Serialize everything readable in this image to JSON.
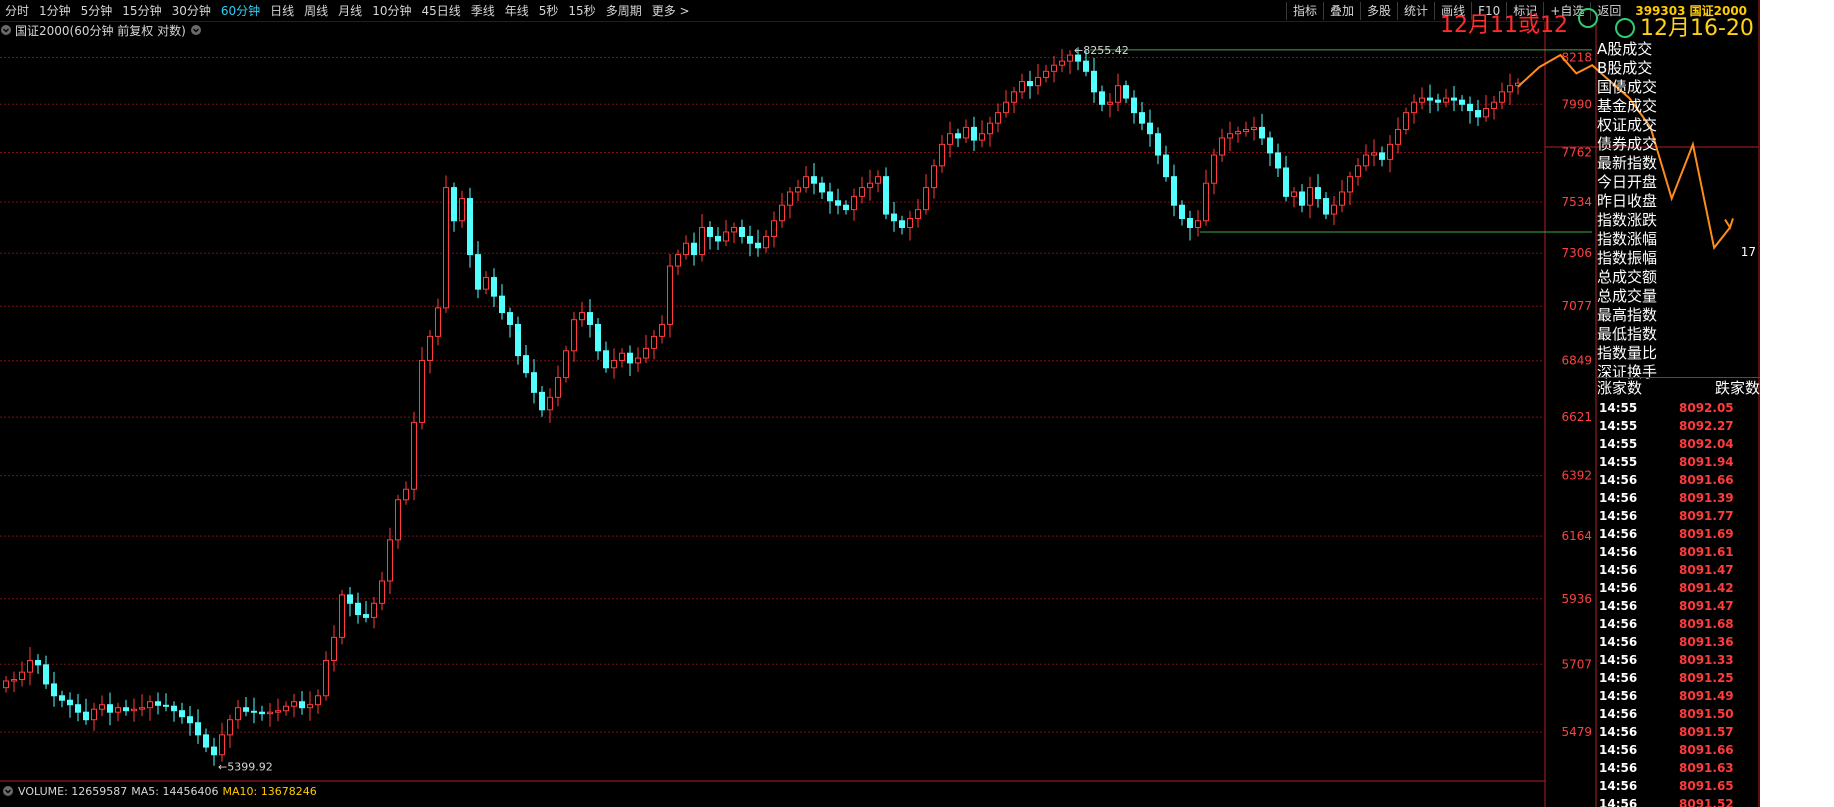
{
  "toolbar": {
    "periods": [
      "分时",
      "1分钟",
      "5分钟",
      "15分钟",
      "30分钟",
      "60分钟",
      "日线",
      "周线",
      "月线",
      "10分钟",
      "45日线",
      "季线",
      "年线",
      "5秒",
      "15秒",
      "多周期",
      "更多 >"
    ],
    "active_period": "60分钟",
    "tools": [
      "指标",
      "叠加",
      "多股",
      "统计",
      "画线",
      "F10",
      "标记",
      "+自选",
      "返回"
    ],
    "index_code": "399303 国证2000"
  },
  "chart_title": "国证2000(60分钟 前复权 对数)",
  "annotations": {
    "red_text": "12月11或12",
    "yellow_text": "12月16-20",
    "right_edge_label": "17"
  },
  "side_panel": {
    "fields": [
      "A股成交",
      "B股成交",
      "国债成交",
      "基金成交",
      "权证成交",
      "债券成交",
      "最新指数",
      "今日开盘",
      "昨日收盘",
      "指数涨跌",
      "指数涨幅",
      "指数振幅",
      "总成交额",
      "总成交量",
      "最高指数",
      "最低指数",
      "指数量比",
      "深证换手"
    ],
    "rise_label": "涨家数",
    "fall_label": "跌家数"
  },
  "ticks": [
    {
      "time": "14:55",
      "price": "8092.05"
    },
    {
      "time": "14:55",
      "price": "8092.27"
    },
    {
      "time": "14:55",
      "price": "8092.04"
    },
    {
      "time": "14:55",
      "price": "8091.94"
    },
    {
      "time": "14:56",
      "price": "8091.66"
    },
    {
      "time": "14:56",
      "price": "8091.39"
    },
    {
      "time": "14:56",
      "price": "8091.77"
    },
    {
      "time": "14:56",
      "price": "8091.69"
    },
    {
      "time": "14:56",
      "price": "8091.61"
    },
    {
      "time": "14:56",
      "price": "8091.47"
    },
    {
      "time": "14:56",
      "price": "8091.42"
    },
    {
      "time": "14:56",
      "price": "8091.47"
    },
    {
      "time": "14:56",
      "price": "8091.68"
    },
    {
      "time": "14:56",
      "price": "8091.36"
    },
    {
      "time": "14:56",
      "price": "8091.33"
    },
    {
      "time": "14:56",
      "price": "8091.25"
    },
    {
      "time": "14:56",
      "price": "8091.49"
    },
    {
      "time": "14:56",
      "price": "8091.50"
    },
    {
      "time": "14:56",
      "price": "8091.57"
    },
    {
      "time": "14:56",
      "price": "8091.66"
    },
    {
      "time": "14:56",
      "price": "8091.63"
    },
    {
      "time": "14:56",
      "price": "8091.65"
    },
    {
      "time": "14:56",
      "price": "8091.52"
    }
  ],
  "volume_bar": {
    "volume_label": "VOLUME: 12659587",
    "ma5_label": "MA5: 14456406",
    "ma10_label": "MA10: 13678246"
  },
  "colors": {
    "up": "#ff3b3b",
    "down": "#54ffff",
    "grid": "#7a1010",
    "axis_text": "#ff4040",
    "level_line": "#3fa84a",
    "projection": "#ff8c1a"
  },
  "chart_data": {
    "type": "candlestick",
    "title": "国证2000(60分钟 前复权 对数)",
    "y_scale": "log",
    "y_ticks": [
      5479,
      5707,
      5936,
      6164,
      6392,
      6621,
      6849,
      7077,
      7306,
      7534,
      7762,
      7990,
      8218
    ],
    "ylim": [
      5330,
      8380
    ],
    "marked_high": "8255.42",
    "marked_low": "5399.92",
    "level_lines": [
      8255.42,
      7400
    ],
    "closes": [
      5650,
      5655,
      5680,
      5720,
      5705,
      5640,
      5600,
      5585,
      5570,
      5545,
      5520,
      5555,
      5570,
      5545,
      5560,
      5550,
      5555,
      5560,
      5580,
      5568,
      5565,
      5550,
      5530,
      5510,
      5470,
      5430,
      5405,
      5470,
      5520,
      5560,
      5548,
      5545,
      5540,
      5545,
      5550,
      5565,
      5580,
      5560,
      5570,
      5600,
      5720,
      5800,
      5950,
      5920,
      5880,
      5870,
      5920,
      6000,
      6150,
      6300,
      6340,
      6600,
      6850,
      6950,
      7070,
      7600,
      7450,
      7550,
      7300,
      7150,
      7200,
      7120,
      7050,
      7000,
      6870,
      6800,
      6720,
      6650,
      6700,
      6780,
      6890,
      7020,
      7050,
      7000,
      6890,
      6820,
      6850,
      6880,
      6840,
      6860,
      6900,
      6950,
      7000,
      7250,
      7300,
      7350,
      7300,
      7420,
      7380,
      7360,
      7400,
      7420,
      7380,
      7350,
      7330,
      7380,
      7450,
      7520,
      7580,
      7600,
      7650,
      7620,
      7580,
      7540,
      7520,
      7500,
      7560,
      7600,
      7620,
      7650,
      7480,
      7450,
      7420,
      7460,
      7500,
      7600,
      7700,
      7800,
      7850,
      7830,
      7880,
      7820,
      7850,
      7900,
      7950,
      8000,
      8050,
      8100,
      8080,
      8120,
      8150,
      8180,
      8200,
      8230,
      8200,
      8150,
      8050,
      7990,
      8000,
      8080,
      8020,
      7950,
      7900,
      7850,
      7750,
      7650,
      7520,
      7460,
      7420,
      7450,
      7620,
      7750,
      7830,
      7850,
      7860,
      7870,
      7880,
      7830,
      7760,
      7690,
      7560,
      7580,
      7520,
      7600,
      7550,
      7480,
      7520,
      7580,
      7650,
      7700,
      7750,
      7760,
      7730,
      7800,
      7870,
      7950,
      8000,
      8020,
      8010,
      8000,
      8020,
      8010,
      7990,
      7960,
      7930,
      7970,
      8000,
      8050,
      8080,
      8092.05
    ],
    "projection": {
      "points": [
        [
          0,
          8075
        ],
        [
          4,
          8170
        ],
        [
          8,
          8230
        ],
        [
          11,
          8140
        ],
        [
          14,
          8180
        ],
        [
          17,
          8110
        ],
        [
          21,
          8020
        ],
        [
          25,
          7880
        ],
        [
          29,
          7550
        ],
        [
          33,
          7800
        ],
        [
          37,
          7330
        ],
        [
          40,
          7420
        ]
      ]
    }
  }
}
